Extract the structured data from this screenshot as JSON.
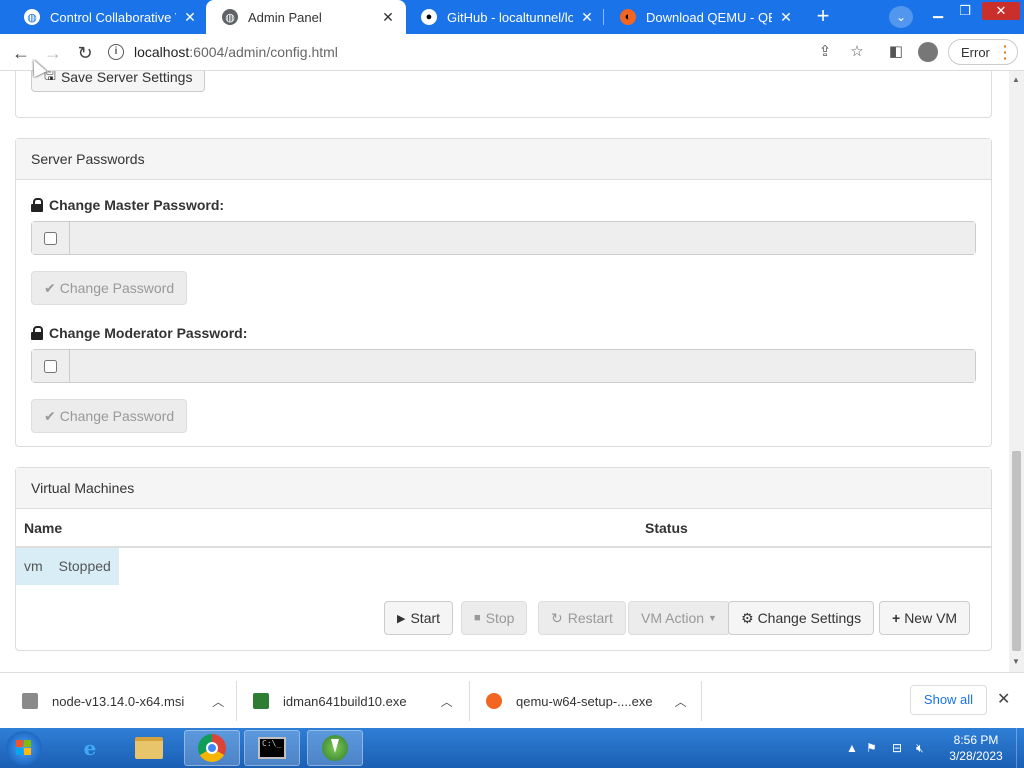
{
  "browser": {
    "tabs": [
      {
        "title": "Control Collaborative Vir",
        "active": false
      },
      {
        "title": "Admin Panel",
        "active": true
      },
      {
        "title": "GitHub - localtunnel/loca",
        "active": false
      },
      {
        "title": "Download QEMU - QEMU",
        "active": false
      }
    ],
    "url_host": "localhost",
    "url_rest": ":6004/admin/config.html",
    "error_label": "Error",
    "new_tab_symbol": "+",
    "colors": {
      "tabstrip": "#1a73e8",
      "accent_text": "#1a73e8"
    }
  },
  "page": {
    "save_settings_label": "Save Server Settings",
    "passwords_panel": {
      "heading": "Server Passwords",
      "master_label": "Change Master Password:",
      "moderator_label": "Change Moderator Password:",
      "change_button_label": "Change Password"
    },
    "vm_panel": {
      "heading": "Virtual Machines",
      "columns": [
        "Name",
        "Status"
      ],
      "rows": [
        {
          "name": "vm",
          "status": "Stopped"
        }
      ],
      "actions": {
        "start": "Start",
        "stop": "Stop",
        "restart": "Restart",
        "vm_action": "VM Action",
        "change_settings": "Change Settings",
        "new_vm": "New VM"
      }
    }
  },
  "downloads": {
    "items": [
      {
        "filename": "node-v13.14.0-x64.msi"
      },
      {
        "filename": "idman641build10.exe"
      },
      {
        "filename": "qemu-w64-setup-....exe"
      }
    ],
    "show_all_label": "Show all"
  },
  "taskbar": {
    "clock_time": "8:56 PM",
    "clock_date": "3/28/2023",
    "apps": [
      "internet-explorer",
      "file-explorer",
      "chrome",
      "command-prompt",
      "internet-download-manager"
    ]
  }
}
